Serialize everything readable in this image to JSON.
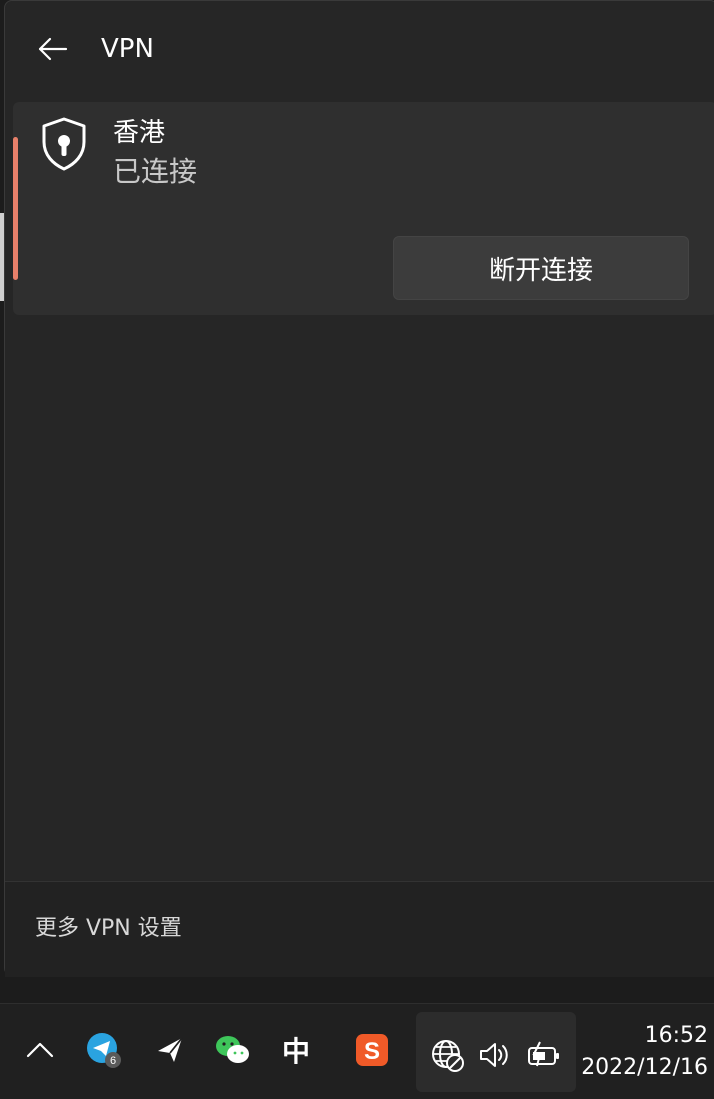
{
  "panel": {
    "title": "VPN",
    "connection": {
      "name": "香港",
      "status": "已连接",
      "disconnect_label": "断开连接"
    },
    "footer": {
      "more_settings_label": "更多 VPN 设置"
    }
  },
  "taskbar": {
    "overflow_icon": "chevron-up-icon",
    "apps": [
      {
        "icon": "telegram-icon",
        "badge": "6"
      },
      {
        "icon": "paper-plane-icon"
      },
      {
        "icon": "wechat-icon"
      },
      {
        "icon": "ime-chinese-icon",
        "label": "中"
      },
      {
        "icon": "sogou-input-icon",
        "label": "S"
      }
    ],
    "system": [
      "globe-no-internet-icon",
      "speaker-icon",
      "battery-charging-icon"
    ],
    "time": "16:52",
    "date": "2022/12/16"
  },
  "colors": {
    "accent": "#e8806a",
    "panel_bg": "#262626",
    "card_bg": "#2f2f2f",
    "taskbar_bg": "#202020"
  }
}
